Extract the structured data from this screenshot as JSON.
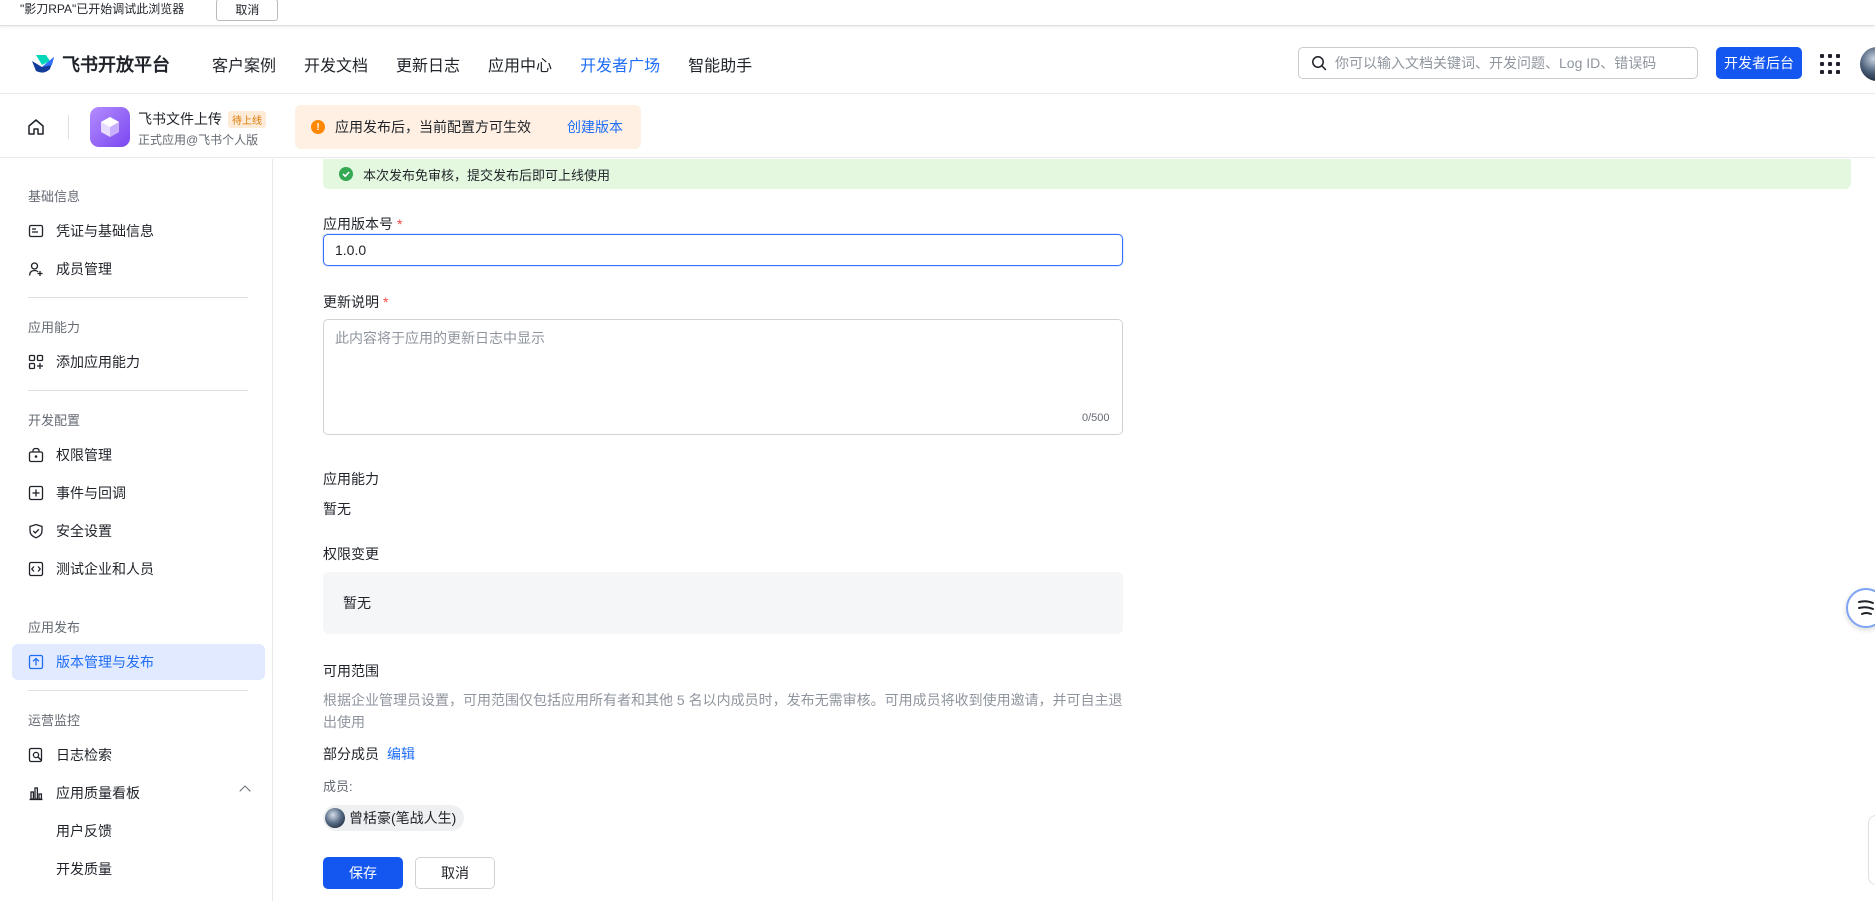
{
  "debug_bar": {
    "message": "\"影刀RPA\"已开始调试此浏览器",
    "cancel_label": "取消"
  },
  "header": {
    "logo_text": "飞书开放平台",
    "nav": [
      {
        "label": "客户案例"
      },
      {
        "label": "开发文档"
      },
      {
        "label": "更新日志"
      },
      {
        "label": "应用中心"
      },
      {
        "label": "开发者广场"
      },
      {
        "label": "智能助手"
      }
    ],
    "active_nav": "开发者广场",
    "search_placeholder": "你可以输入文档关键词、开发问题、Log ID、错误码",
    "dev_console_label": "开发者后台"
  },
  "app_bar": {
    "app_name": "飞书文件上传",
    "status_badge": "待上线",
    "app_subtitle": "正式应用@飞书个人版",
    "notice_text": "应用发布后，当前配置方可生效",
    "notice_link": "创建版本"
  },
  "sidebar": {
    "sections": [
      {
        "title": "基础信息",
        "items": [
          {
            "label": "凭证与基础信息",
            "icon": "credential-icon"
          },
          {
            "label": "成员管理",
            "icon": "user-add-icon"
          }
        ]
      },
      {
        "title": "应用能力",
        "items": [
          {
            "label": "添加应用能力",
            "icon": "grid-add-icon"
          }
        ]
      },
      {
        "title": "开发配置",
        "items": [
          {
            "label": "权限管理",
            "icon": "lock-bag-icon"
          },
          {
            "label": "事件与回调",
            "icon": "event-icon"
          },
          {
            "label": "安全设置",
            "icon": "shield-icon"
          },
          {
            "label": "测试企业和人员",
            "icon": "code-icon"
          }
        ]
      },
      {
        "title": "应用发布",
        "items": [
          {
            "label": "版本管理与发布",
            "icon": "upload-icon"
          }
        ]
      },
      {
        "title": "运营监控",
        "items": [
          {
            "label": "日志检索",
            "icon": "log-search-icon"
          },
          {
            "label": "应用质量看板",
            "icon": "chart-icon"
          },
          {
            "label": "用户反馈"
          },
          {
            "label": "开发质量"
          }
        ]
      }
    ],
    "active_item": "版本管理与发布"
  },
  "main": {
    "success_notice": "本次发布免审核，提交发布后即可上线使用",
    "version_label": "应用版本号",
    "version_value": "1.0.0",
    "update_label": "更新说明",
    "update_placeholder": "此内容将于应用的更新日志中显示",
    "update_counter": "0/500",
    "ability_label": "应用能力",
    "ability_value": "暂无",
    "permission_label": "权限变更",
    "permission_value": "暂无",
    "scope_label": "可用范围",
    "scope_desc": "根据企业管理员设置，可用范围仅包括应用所有者和其他 5 名以内成员时，发布无需审核。可用成员将收到使用邀请，并可自主退出使用",
    "scope_value": "部分成员",
    "edit_label": "编辑",
    "members_label": "成员:",
    "member_name": "曾栝豪(笔战人生)",
    "save_label": "保存",
    "cancel_label": "取消"
  },
  "colors": {
    "primary": "#1456f0",
    "link": "#1f6ef5",
    "success_bg": "#e4f8e0",
    "notice_bg": "#fff0e3",
    "active_bg": "#e1eaff"
  }
}
